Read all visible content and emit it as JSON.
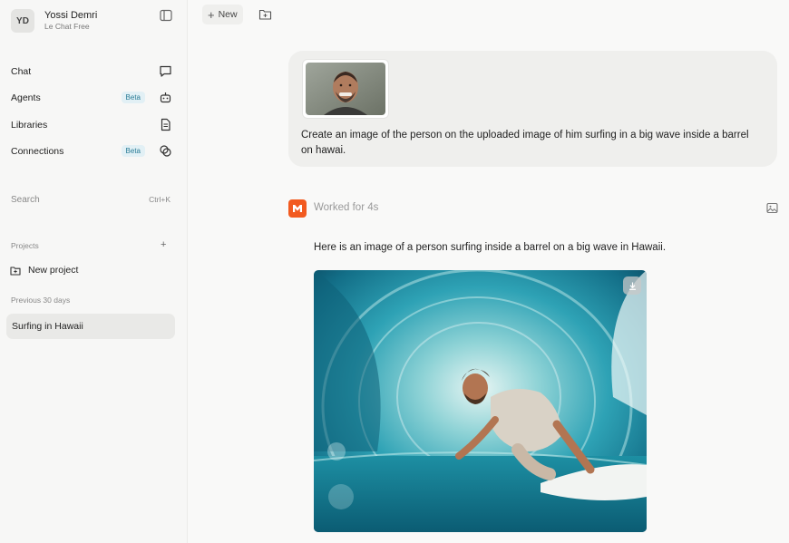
{
  "user": {
    "initials": "YD",
    "name": "Yossi Demri",
    "plan": "Le Chat Free"
  },
  "sidebar": {
    "nav": [
      {
        "label": "Chat",
        "icon": "chat-bubble-icon"
      },
      {
        "label": "Agents",
        "badge": "Beta",
        "icon": "robot-icon"
      },
      {
        "label": "Libraries",
        "icon": "document-icon"
      },
      {
        "label": "Connections",
        "badge": "Beta",
        "icon": "connections-icon"
      }
    ],
    "search": {
      "label": "Search",
      "shortcut": "Ctrl+K"
    },
    "projects_label": "Projects",
    "projects_add": "+",
    "new_project": "New project",
    "history_label": "Previous 30 days",
    "conversations": [
      "Surfing in Hawaii"
    ]
  },
  "toolbar": {
    "new_label": "New",
    "new_plus": "+"
  },
  "conversation": {
    "user_message": "Create an image of the person on the uploaded image of him surfing in a big wave inside a barrel on hawai.",
    "status": "Worked for 4s",
    "assistant_message": "Here is an image of a person surfing inside a barrel on a big wave in Hawaii."
  },
  "colors": {
    "accent_badge_bg": "#e2f0f5",
    "accent_badge_text": "#2a7c96",
    "brand_orange": "#f25a1f"
  }
}
